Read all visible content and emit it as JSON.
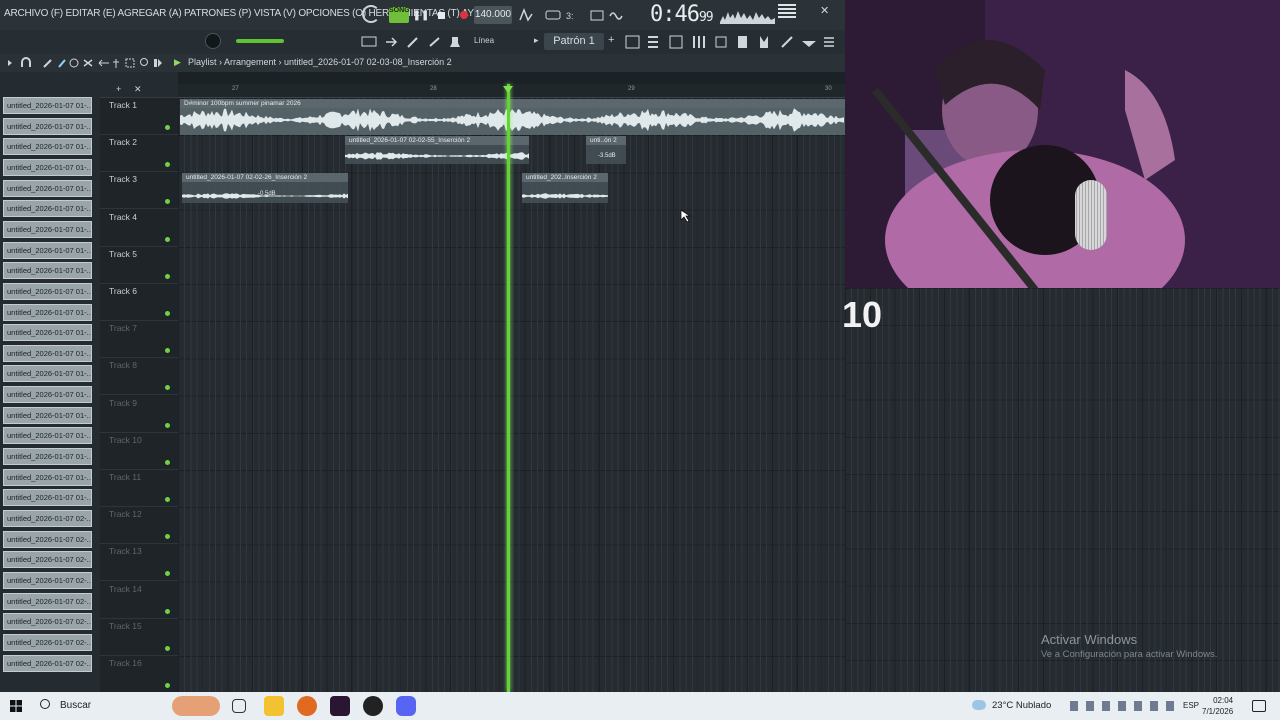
{
  "menu": "ARCHIVO (F) EDITAR (E) AGREGAR (A) PATRONES (P) VISTA (V) OPCIONES (O) HERRAMIENTAS (T) AYUDA",
  "transport": {
    "mode": "SONG",
    "tempo": "140.000",
    "time_main": "0:46",
    "time_sub": "99"
  },
  "toolbar2": {
    "snap": "Línea",
    "pattern": "Patrón 1"
  },
  "playlist": {
    "breadcrumb": "Playlist › Arrangement › untitled_2026-01-07 02-03-08_Inserción 2"
  },
  "ruler": [
    "27",
    "28",
    "29",
    "30"
  ],
  "browser_items": [
    "untitled_2026-01-07 01-...",
    "untitled_2026-01-07 01-...",
    "untitled_2026-01-07 01-...",
    "untitled_2026-01-07 01-...",
    "untitled_2026-01-07 01-...",
    "untitled_2026-01-07 01-...",
    "untitled_2026-01-07 01-...",
    "untitled_2026-01-07 01-...",
    "untitled_2026-01-07 01-...",
    "untitled_2026-01-07 01-...",
    "untitled_2026-01-07 01-...",
    "untitled_2026-01-07 01-...",
    "untitled_2026-01-07 01-...",
    "untitled_2026-01-07 01-...",
    "untitled_2026-01-07 01-...",
    "untitled_2026-01-07 01-...",
    "untitled_2026-01-07 01-...",
    "untitled_2026-01-07 01-...",
    "untitled_2026-01-07 01-...",
    "untitled_2026-01-07 01-...",
    "untitled_2026-01-07 02-...",
    "untitled_2026-01-07 02-...",
    "untitled_2026-01-07 02-...",
    "untitled_2026-01-07 02-...",
    "untitled_2026-01-07 02-...",
    "untitled_2026-01-07 02-...",
    "untitled_2026-01-07 02-...",
    "untitled_2026-01-07 02-..."
  ],
  "tracks": [
    "Track 1",
    "Track 2",
    "Track 3",
    "Track 4",
    "Track 5",
    "Track 6",
    "Track 7",
    "Track 8",
    "Track 9",
    "Track 10",
    "Track 11",
    "Track 12",
    "Track 13",
    "Track 14",
    "Track 15",
    "Track 16"
  ],
  "clips": {
    "c1": {
      "title": "D#minor 100bpm summer pinamar 2026"
    },
    "c2": {
      "title": "untitled_2026-01-07 02-02-55_Inserción 2"
    },
    "c3": {
      "title": "unti..ón 2",
      "gain": "-3.5dB"
    },
    "c4": {
      "title": "untitled_2026-01-07 02-02-26_Inserción 2",
      "gain": "-0.5dB"
    },
    "c5": {
      "title": "untitled_202..Inserción 2"
    }
  },
  "overlay_counter": "10",
  "watermark": {
    "title": "Activar Windows",
    "sub": "Ve a Configuración para activar Windows."
  },
  "taskbar": {
    "search": "Buscar",
    "weather": "23°C  Nublado",
    "lang": "ESP",
    "time": "02:04",
    "date": "7/1/2026"
  }
}
